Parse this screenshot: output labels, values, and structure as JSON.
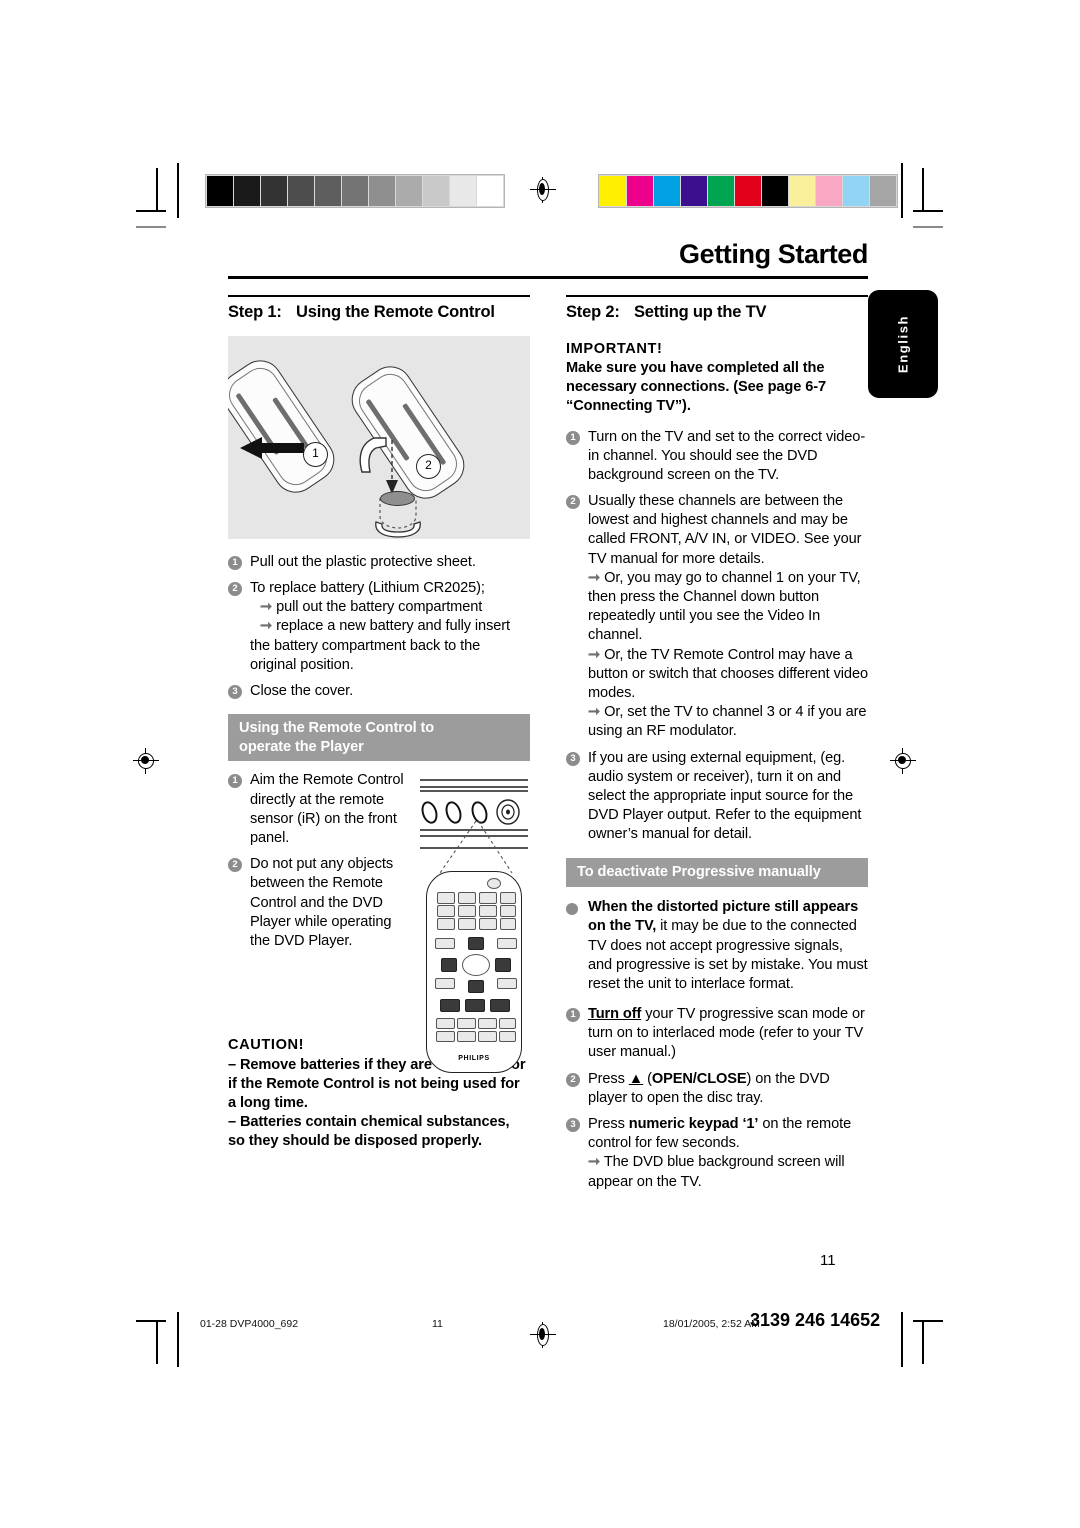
{
  "document": {
    "header_title": "Getting Started",
    "page_number": "11",
    "language_tab": "English"
  },
  "printer_marks": {
    "grayscale_bar": [
      "#000000",
      "#1a1a1a",
      "#333333",
      "#4d4d4d",
      "#5e5e5e",
      "#747474",
      "#8f8f8f",
      "#ababab",
      "#c9c9c9",
      "#e8e8e8",
      "#ffffff"
    ],
    "color_bar": [
      "#fff000",
      "#ec008c",
      "#00a0e3",
      "#3b0f8f",
      "#00a551",
      "#e2001a",
      "#000000",
      "#faef9b",
      "#f9a8c4",
      "#92d4f4",
      "#a5a5a5"
    ]
  },
  "left_column": {
    "step_label": "Step 1:",
    "step_title": "Using the Remote Control",
    "figure": {
      "callout_1": "1",
      "callout_2": "2",
      "alt": "remote-control-battery-replacement-diagram"
    },
    "steps": [
      {
        "num": "1",
        "text": "Pull out the plastic protective sheet."
      },
      {
        "num": "2",
        "text": "To replace battery (Lithium CR2025);",
        "arrows": [
          "pull out the battery compartment",
          "replace a new battery and fully insert"
        ],
        "cont": "the battery compartment back to the original position."
      },
      {
        "num": "3",
        "text": "Close the cover."
      }
    ],
    "subsection": {
      "bar_line1": "Using the Remote Control to",
      "bar_line2": "operate the Player",
      "steps": [
        {
          "num": "1",
          "text": "Aim the Remote Control directly at the remote sensor (iR) on the front panel."
        },
        {
          "num": "2",
          "text": "Do not put any objects between the Remote Control and the DVD Player while operating the DVD Player."
        }
      ],
      "figure_alt": "dvd-player-front-panel-and-remote-control",
      "remote_brand": "PHILIPS"
    },
    "caution": {
      "title": "CAUTION!",
      "items": [
        "–  Remove batteries if they are exhausted or if the Remote Control is not being used for a long time.",
        "–  Batteries contain chemical substances, so they should be disposed properly."
      ]
    }
  },
  "right_column": {
    "step_label": "Step 2:",
    "step_title": "Setting up the TV",
    "important": {
      "title": "IMPORTANT!",
      "text": "Make sure you have completed all the necessary connections. (See page 6-7 “Connecting TV”)."
    },
    "steps": [
      {
        "num": "1",
        "text": "Turn on the TV and set to the correct video-in channel. You should see the DVD background screen on the TV."
      },
      {
        "num": "2",
        "text": "Usually these channels are between the lowest and highest channels and may be called FRONT, A/V IN, or VIDEO. See your TV manual for more details.",
        "arrows": [
          "Or, you may go to channel 1 on your TV, then press the Channel down button repeatedly until you see the Video In channel.",
          "Or, the TV Remote Control may have a button or switch that chooses different video modes.",
          "Or, set the TV to channel 3 or 4 if you are using an RF modulator."
        ]
      },
      {
        "num": "3",
        "text": "If you are using external equipment, (eg. audio system or receiver), turn it on and select the appropriate input source for the DVD Player output. Refer to the equipment owner’s manual for detail."
      }
    ],
    "progressive": {
      "bar": "To deactivate Progressive manually",
      "intro_bold": "When the distorted picture still appears on the TV,",
      "intro_rest": " it may be due to the connected TV does not accept progressive signals, and progressive is set by mistake. You must reset the unit to interlace format.",
      "steps": [
        {
          "num": "1",
          "bold_underline": "Turn off",
          "rest": " your TV progressive scan mode or turn on to interlaced mode (refer to your TV user manual.)"
        },
        {
          "num": "2",
          "pre": "Press ",
          "symbol": "▲",
          "mid": " (",
          "bold": "OPEN/CLOSE",
          "rest": ") on the DVD player to open the disc tray."
        },
        {
          "num": "3",
          "pre": "Press ",
          "bold": "numeric keypad ‘1’",
          "rest": " on the remote control for few seconds.",
          "arrow": "The DVD blue background screen will appear on the TV."
        }
      ]
    }
  },
  "footer": {
    "left": "01-28 DVP4000_692",
    "center": "11",
    "date": "18/01/2005, 2:52 AM",
    "code": "3139 246 14652"
  }
}
